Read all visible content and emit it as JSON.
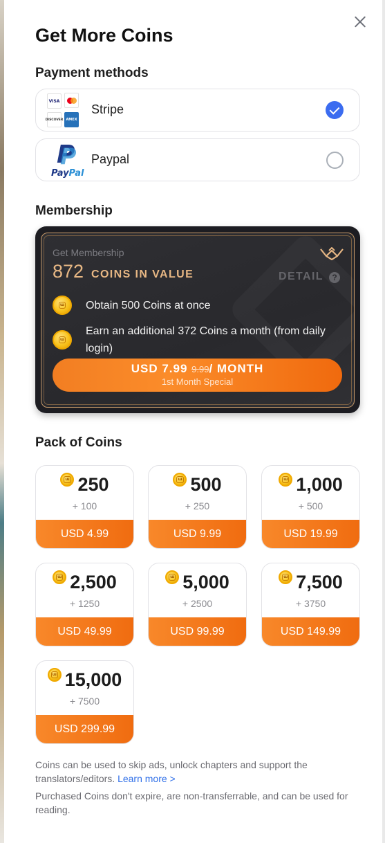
{
  "title": "Get More Coins",
  "payment": {
    "heading": "Payment methods",
    "options": [
      {
        "label": "Stripe",
        "selected": true,
        "cards": [
          "VISA",
          "",
          "DISCOVER",
          "AMEX"
        ]
      },
      {
        "label": "Paypal",
        "selected": false,
        "logo_pay": "Pay",
        "logo_pal": "Pal"
      }
    ]
  },
  "membership": {
    "heading": "Membership",
    "small_label": "Get Membership",
    "coins_value": "872",
    "coins_unit": "COINS IN VALUE",
    "detail_label": "DETAIL",
    "detail_icon_char": "?",
    "benefits": [
      "Obtain 500 Coins at once",
      "Earn an additional 372 Coins a month (from daily login)"
    ],
    "button_prefix": "USD 7.99 ",
    "button_old_price": "9.99",
    "button_suffix": "/ MONTH",
    "button_sub": "1st Month Special",
    "accent_color": "#e7b784"
  },
  "packs": {
    "heading": "Pack of Coins",
    "items": [
      {
        "amount": "250",
        "bonus": "+ 100",
        "price": "USD 4.99"
      },
      {
        "amount": "500",
        "bonus": "+ 250",
        "price": "USD 9.99"
      },
      {
        "amount": "1,000",
        "bonus": "+ 500",
        "price": "USD 19.99"
      },
      {
        "amount": "2,500",
        "bonus": "+ 1250",
        "price": "USD 49.99"
      },
      {
        "amount": "5,000",
        "bonus": "+ 2500",
        "price": "USD 99.99"
      },
      {
        "amount": "7,500",
        "bonus": "+ 3750",
        "price": "USD 149.99"
      },
      {
        "amount": "15,000",
        "bonus": "+ 7500",
        "price": "USD 299.99"
      }
    ]
  },
  "footer": {
    "line1": "Coins can be used to skip ads, unlock chapters and support the translators/editors. ",
    "learn_more": "Learn more >",
    "line2": "Purchased Coins don't expire, are non-transferrable, and can be used for reading."
  },
  "coin_glyph": "ɯ",
  "colors": {
    "primary_orange": "#f27e22",
    "select_blue": "#3b6cf0"
  }
}
